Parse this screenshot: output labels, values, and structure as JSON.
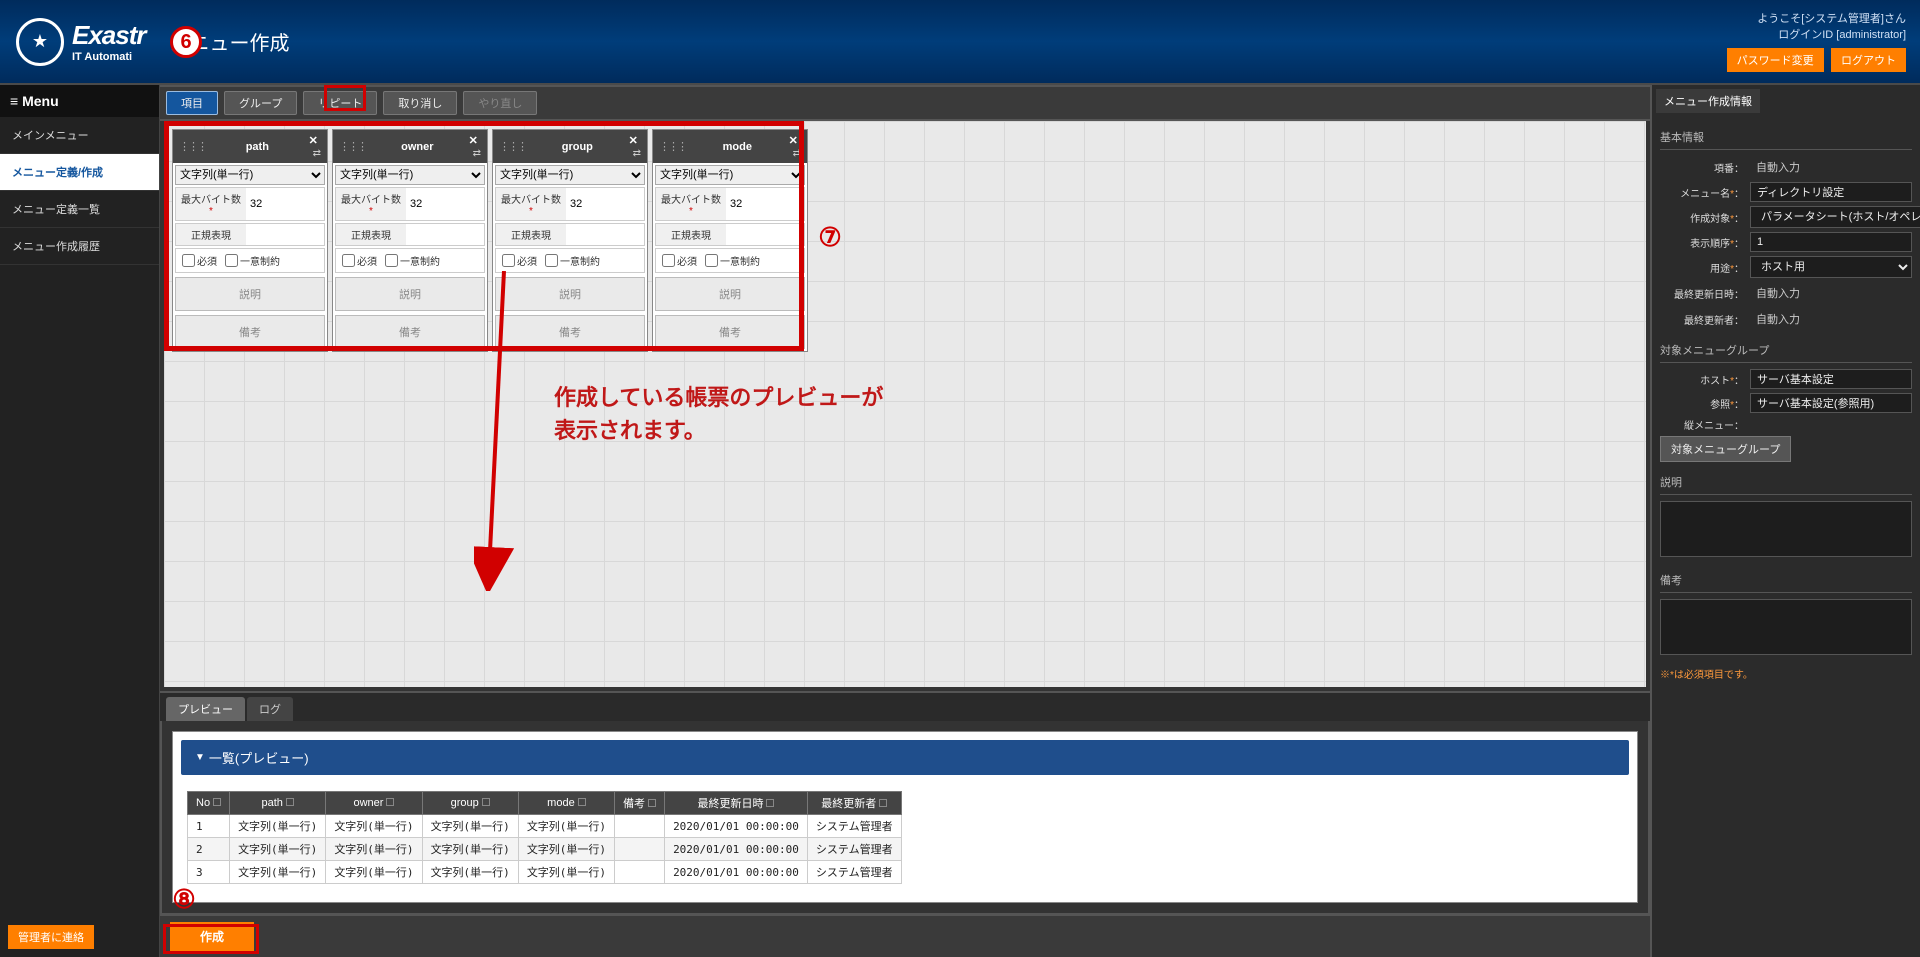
{
  "logo": {
    "big": "Exastr",
    "small": "IT Automati"
  },
  "page_title": "メニュー作成",
  "header": {
    "welcome": "ようこそ[システム管理者]さん",
    "login_id": "ログインID [administrator]",
    "btn_pwchange": "パスワード変更",
    "btn_logout": "ログアウト"
  },
  "sidebar": {
    "menu_label": "Menu",
    "items": [
      {
        "label": "メインメニュー"
      },
      {
        "label": "メニュー定義/作成"
      },
      {
        "label": "メニュー定義一覧"
      },
      {
        "label": "メニュー作成履歴"
      }
    ],
    "active_index": 1
  },
  "toolbar": {
    "item": "項目",
    "group": "グループ",
    "repeat": "リピート",
    "undo": "取り消し",
    "redo": "やり直し"
  },
  "cards": [
    {
      "title": "path",
      "type_value": "文字列(単一行)",
      "maxbytes_label": "最大バイト数",
      "maxbytes": "32",
      "regex_label": "正規表現",
      "regex": "",
      "req_label": "必須",
      "uniq_label": "一意制約",
      "btn_desc": "説明",
      "btn_remark": "備考"
    },
    {
      "title": "owner",
      "type_value": "文字列(単一行)",
      "maxbytes_label": "最大バイト数",
      "maxbytes": "32",
      "regex_label": "正規表現",
      "regex": "",
      "req_label": "必須",
      "uniq_label": "一意制約",
      "btn_desc": "説明",
      "btn_remark": "備考"
    },
    {
      "title": "group",
      "type_value": "文字列(単一行)",
      "maxbytes_label": "最大バイト数",
      "maxbytes": "32",
      "regex_label": "正規表現",
      "regex": "",
      "req_label": "必須",
      "uniq_label": "一意制約",
      "btn_desc": "説明",
      "btn_remark": "備考"
    },
    {
      "title": "mode",
      "type_value": "文字列(単一行)",
      "maxbytes_label": "最大バイト数",
      "maxbytes": "32",
      "regex_label": "正規表現",
      "regex": "",
      "req_label": "必須",
      "uniq_label": "一意制約",
      "btn_desc": "説明",
      "btn_remark": "備考"
    }
  ],
  "annotations": {
    "six": "6",
    "seven": "⑦",
    "eight": "⑧",
    "text_line1": "作成している帳票のプレビューが",
    "text_line2": "表示されます。"
  },
  "preview_tabs": {
    "preview": "プレビュー",
    "log": "ログ"
  },
  "preview": {
    "title": "一覧(プレビュー)",
    "headers": [
      "No",
      "path",
      "owner",
      "group",
      "mode",
      "備考",
      "最終更新日時",
      "最終更新者"
    ],
    "rows": [
      {
        "no": "1",
        "path": "文字列(単一行)",
        "owner": "文字列(単一行)",
        "group": "文字列(単一行)",
        "mode": "文字列(単一行)",
        "remark": "",
        "updated": "2020/01/01 00:00:00",
        "updater": "システム管理者"
      },
      {
        "no": "2",
        "path": "文字列(単一行)",
        "owner": "文字列(単一行)",
        "group": "文字列(単一行)",
        "mode": "文字列(単一行)",
        "remark": "",
        "updated": "2020/01/01 00:00:00",
        "updater": "システム管理者"
      },
      {
        "no": "3",
        "path": "文字列(単一行)",
        "owner": "文字列(単一行)",
        "group": "文字列(単一行)",
        "mode": "文字列(単一行)",
        "remark": "",
        "updated": "2020/01/01 00:00:00",
        "updater": "システム管理者"
      }
    ]
  },
  "bottom": {
    "create": "作成"
  },
  "right": {
    "tab": "メニュー作成情報",
    "basic_title": "基本情報",
    "fields": {
      "item_no_label": "項番：",
      "item_no": "自動入力",
      "menu_name_label": "メニュー名",
      "menu_name": "ディレクトリ設定",
      "target_label": "作成対象",
      "target": "パラメータシート(ホスト/オペレー",
      "order_label": "表示順序",
      "order": "1",
      "use_label": "用途",
      "use": "ホスト用",
      "updated_label": "最終更新日時：",
      "updated": "自動入力",
      "updater_label": "最終更新者：",
      "updater": "自動入力"
    },
    "group_title": "対象メニューグループ",
    "host_label": "ホスト",
    "host_val": "サーバ基本設定",
    "ref_label": "参照",
    "ref_val": "サーバ基本設定(参照用)",
    "vmenu_label": "縦メニュー：",
    "group_btn": "対象メニューグループ",
    "desc_title": "説明",
    "remark_title": "備考",
    "required_note": "※*は必須項目です。"
  },
  "admin_contact": "管理者に連絡"
}
